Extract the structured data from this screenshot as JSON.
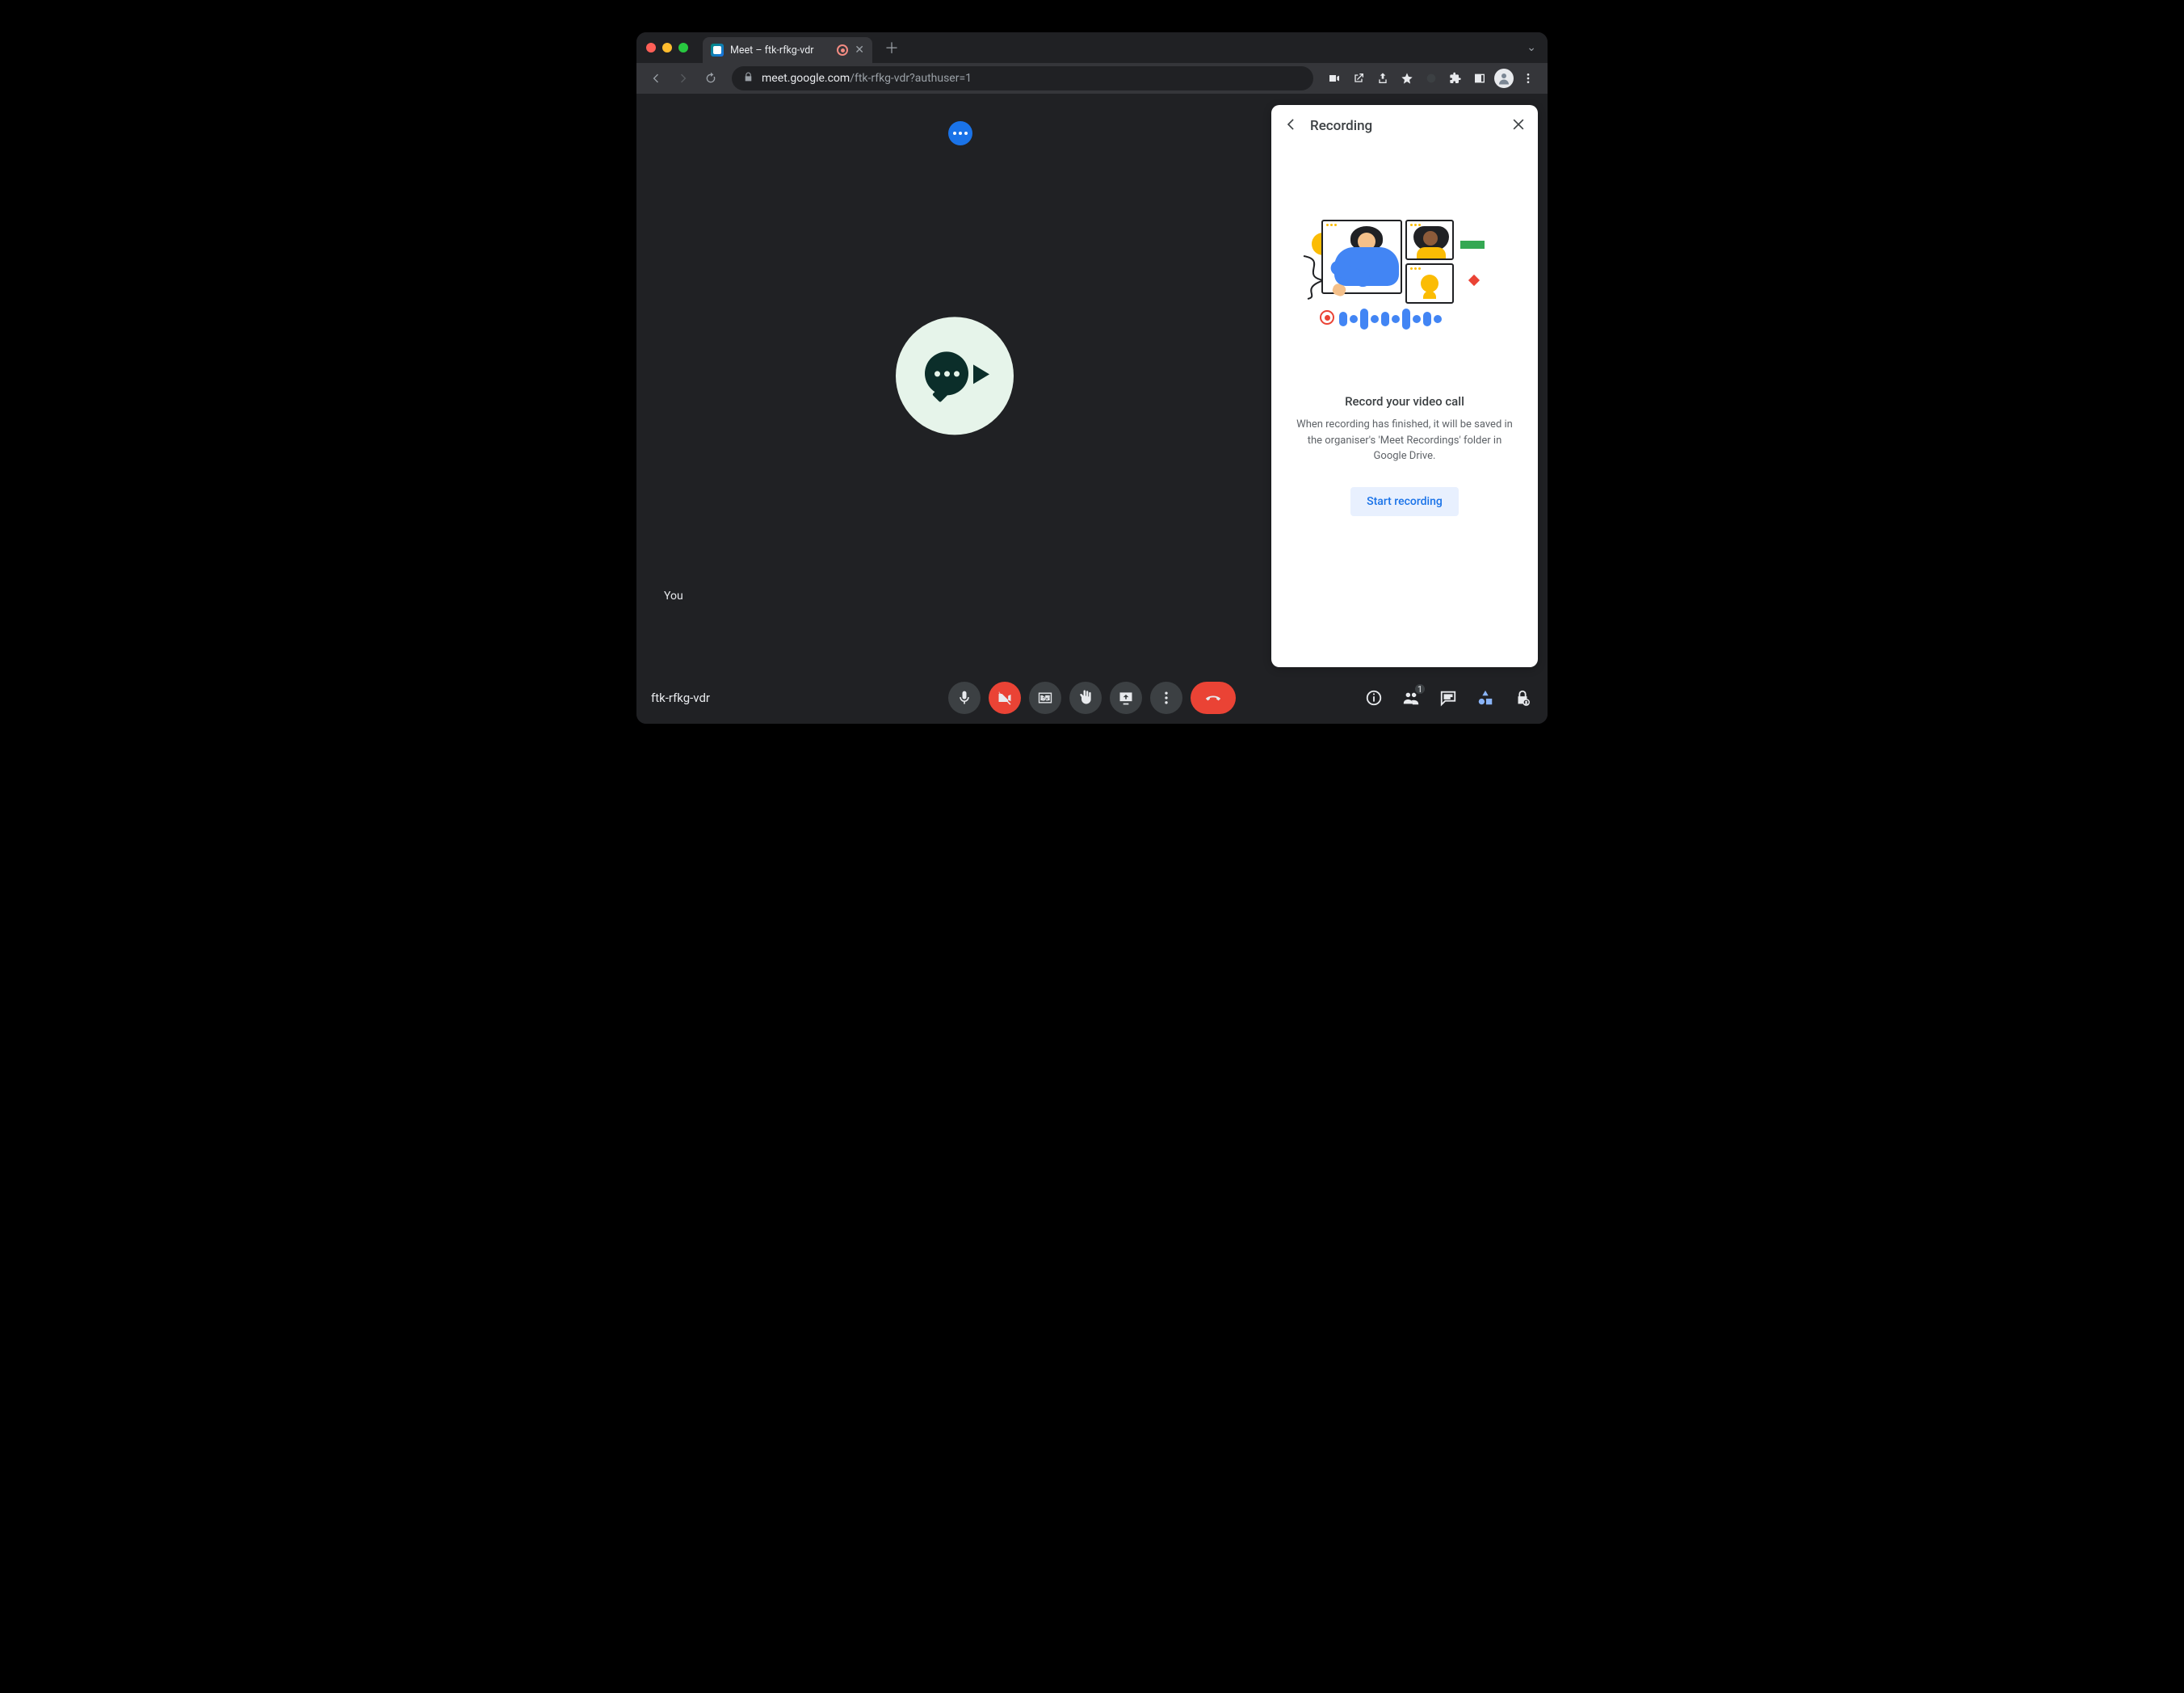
{
  "browser": {
    "tab_title": "Meet – ftk-rfkg-vdr",
    "url_host": "meet.google.com",
    "url_path": "/ftk-rfkg-vdr?authuser=1"
  },
  "meeting": {
    "self_label": "You",
    "meeting_id": "ftk-rfkg-vdr",
    "participant_count": "1"
  },
  "panel": {
    "title": "Recording",
    "heading": "Record your video call",
    "description": "When recording has finished, it will be saved in the organiser's 'Meet Recordings' folder in Google Drive.",
    "cta_label": "Start recording"
  }
}
